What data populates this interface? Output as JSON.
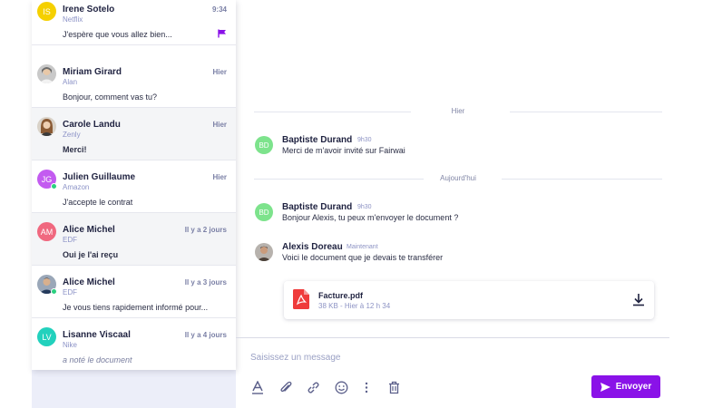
{
  "conversations": [
    {
      "name": "Irene Sotelo",
      "company": "Netflix",
      "time": "9:34",
      "preview": "J'espère que vous allez bien...",
      "initials": "IS",
      "avatar_color": "#f5d000",
      "flagged": true
    },
    {
      "name": "Miriam Girard",
      "company": "Alan",
      "time": "Hier",
      "preview": "Bonjour, comment vas tu?",
      "avatar": "photo"
    },
    {
      "name": "Carole Landu",
      "company": "Zenly",
      "time": "Hier",
      "preview": "Merci!",
      "avatar": "photo",
      "unread": true
    },
    {
      "name": "Julien Guillaume",
      "company": "Amazon",
      "time": "Hier",
      "preview": "J'accepte le contrat",
      "initials": "JG",
      "avatar_color": "#c35bf0",
      "online": true
    },
    {
      "name": "Alice Michel",
      "company": "EDF",
      "time": "Il y a 2 jours",
      "preview": "Oui je l'ai reçu",
      "initials": "AM",
      "avatar_color": "#f0687f",
      "unread": true
    },
    {
      "name": "Alice Michel",
      "company": "EDF",
      "time": "Il y a 3 jours",
      "preview": "Je vous tiens rapidement informé pour...",
      "avatar": "photo",
      "online": true
    },
    {
      "name": "Lisanne Viscaal",
      "company": "Nike",
      "time": "Il y a 4 jours",
      "preview": "a noté le document",
      "initials": "LV",
      "avatar_color": "#22d1bd",
      "italic": true
    }
  ],
  "chat": {
    "day_dividers": [
      "Hier",
      "Aujourd'hui"
    ],
    "messages": [
      {
        "sender": "Baptiste Durand",
        "initials": "BD",
        "avatar_color": "#7de38c",
        "time": "9h30",
        "text": "Merci de m'avoir invité sur Fairwai"
      },
      {
        "sender": "Baptiste Durand",
        "initials": "BD",
        "avatar_color": "#7de38c",
        "time": "9h30",
        "text": "Bonjour Alexis, tu peux m'envoyer le document ?"
      },
      {
        "sender": "Alexis Doreau",
        "time": "Maintenant",
        "text": "Voici le document que je devais te transférer",
        "avatar": "photo"
      }
    ],
    "attachment": {
      "filename": "Facture.pdf",
      "meta": "38 KB - Hier à 12 h 34",
      "icon": "pdf-icon"
    }
  },
  "composer": {
    "placeholder": "Saisissez un message",
    "send_label": "Envoyer",
    "tools": [
      "text-format-icon",
      "paperclip-icon",
      "link-icon",
      "emoji-icon",
      "more-vertical-icon",
      "trash-icon"
    ]
  },
  "colors": {
    "accent": "#8a12e8",
    "muted_text": "#8c93c7",
    "flag": "#8a12e8"
  }
}
